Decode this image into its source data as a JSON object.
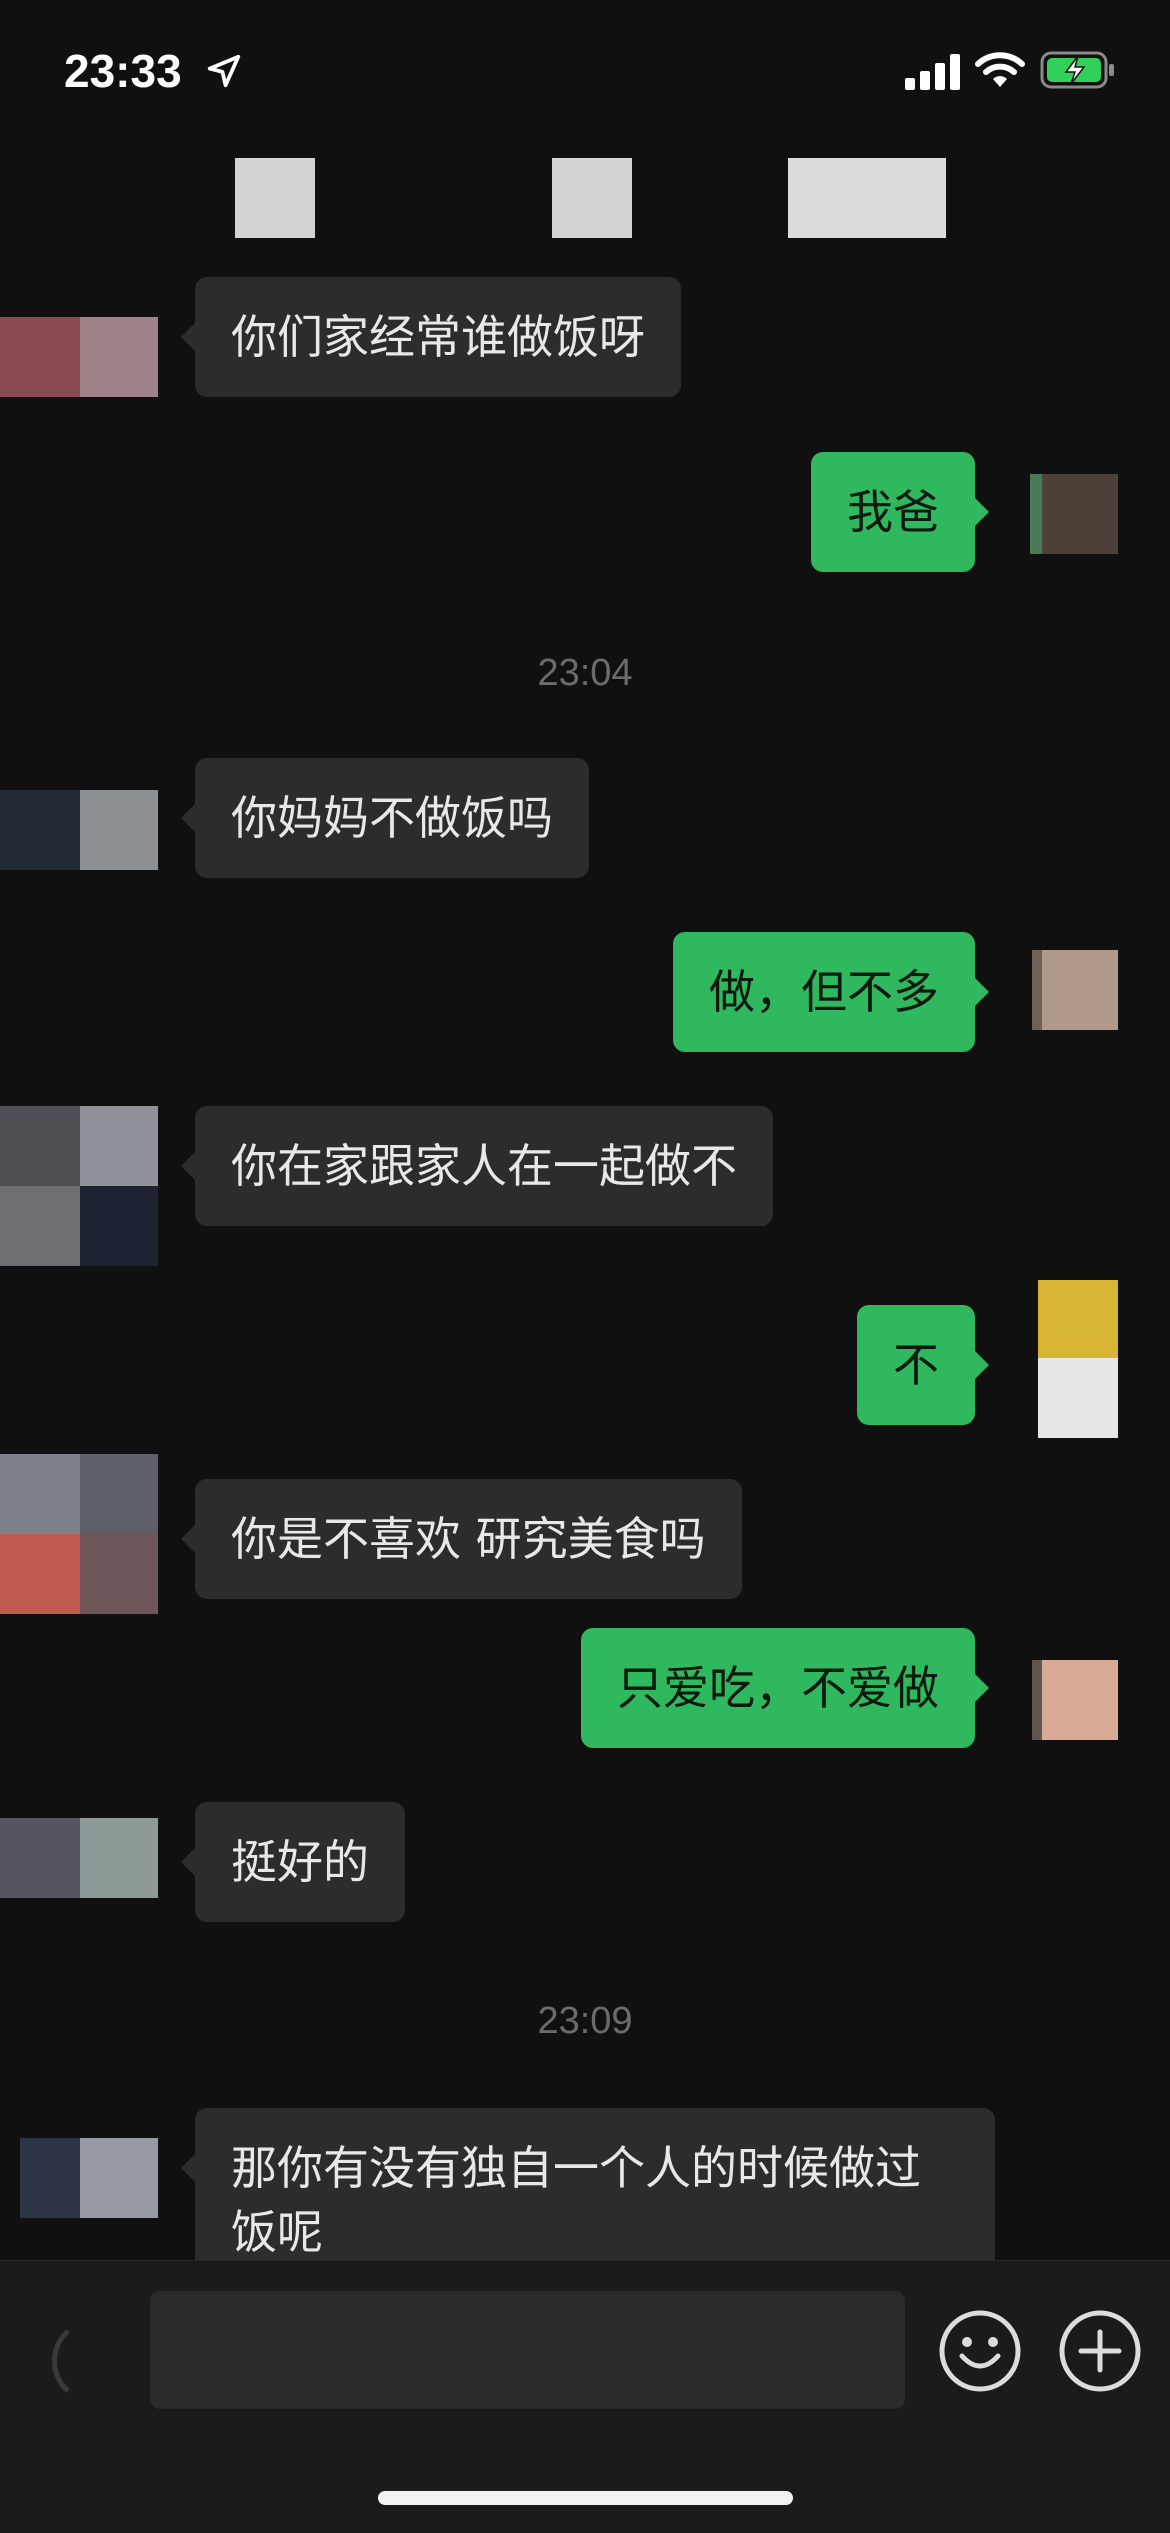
{
  "status_bar": {
    "time": "23:33",
    "icons": [
      "location-arrow-icon",
      "cellular-signal-icon",
      "wifi-icon",
      "battery-charging-icon"
    ],
    "battery_color": "#30d158"
  },
  "colors": {
    "background": "#101010",
    "incoming_bubble": "#2c2c2c",
    "outgoing_bubble": "#2fb85e",
    "timestamp": "#6b6b6b"
  },
  "messages": [
    {
      "from": "them",
      "text": "你们家经常谁做饭呀"
    },
    {
      "from": "me",
      "text": "我爸"
    },
    {
      "type": "time",
      "text": "23:04"
    },
    {
      "from": "them",
      "text": "你妈妈不做饭吗"
    },
    {
      "from": "me",
      "text": "做，但不多"
    },
    {
      "from": "them",
      "text": "你在家跟家人在一起做不"
    },
    {
      "from": "me",
      "text": "不"
    },
    {
      "from": "them",
      "text": "你是不喜欢 研究美食吗"
    },
    {
      "from": "me",
      "text": "只爱吃，不爱做"
    },
    {
      "from": "them",
      "text": "挺好的"
    },
    {
      "type": "time",
      "text": "23:09"
    },
    {
      "from": "them",
      "text": "那你有没有独自一个人的时候做过饭呢"
    }
  ],
  "input_bar": {
    "icons": [
      "voice-icon",
      "emoji-icon",
      "plus-icon"
    ]
  }
}
